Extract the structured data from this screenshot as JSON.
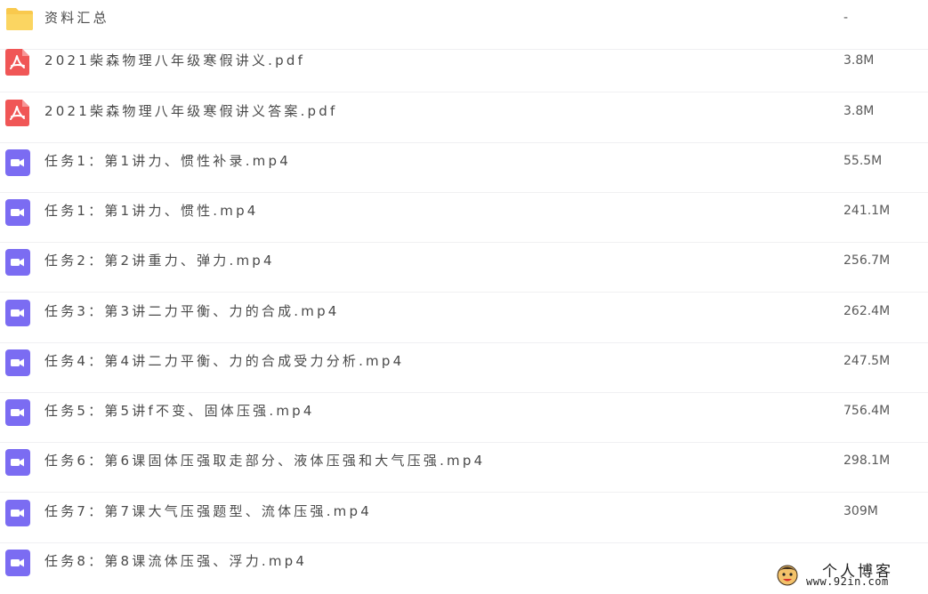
{
  "files": [
    {
      "name": "资料汇总",
      "size": "-",
      "icon": "folder-icon"
    },
    {
      "name": "2021柴森物理八年级寒假讲义.pdf",
      "size": "3.8M",
      "icon": "pdf-icon"
    },
    {
      "name": "2021柴森物理八年级寒假讲义答案.pdf",
      "size": "3.8M",
      "icon": "pdf-icon"
    },
    {
      "name": "任务1：第1讲力、惯性补录.mp4",
      "size": "55.5M",
      "icon": "video-icon"
    },
    {
      "name": "任务1：第1讲力、惯性.mp4",
      "size": "241.1M",
      "icon": "video-icon"
    },
    {
      "name": "任务2：第2讲重力、弹力.mp4",
      "size": "256.7M",
      "icon": "video-icon"
    },
    {
      "name": "任务3：第3讲二力平衡、力的合成.mp4",
      "size": "262.4M",
      "icon": "video-icon"
    },
    {
      "name": "任务4：第4讲二力平衡、力的合成受力分析.mp4",
      "size": "247.5M",
      "icon": "video-icon"
    },
    {
      "name": "任务5：第5讲f不变、固体压强.mp4",
      "size": "756.4M",
      "icon": "video-icon"
    },
    {
      "name": "任务6：第6课固体压强取走部分、液体压强和大气压强.mp4",
      "size": "298.1M",
      "icon": "video-icon"
    },
    {
      "name": "任务7：第7课大气压强题型、流体压强.mp4",
      "size": "309M",
      "icon": "video-icon"
    },
    {
      "name": "任务8：第8课流体压强、浮力.mp4",
      "size": "",
      "icon": "video-icon"
    }
  ],
  "watermark": {
    "title": "个人博客",
    "url": "www.92in.com"
  },
  "colors": {
    "folder": "#f9c94d",
    "pdf": "#f05656",
    "video": "#7b6cf2",
    "text": "#4a4a4a",
    "divider": "#f0f0f2"
  }
}
